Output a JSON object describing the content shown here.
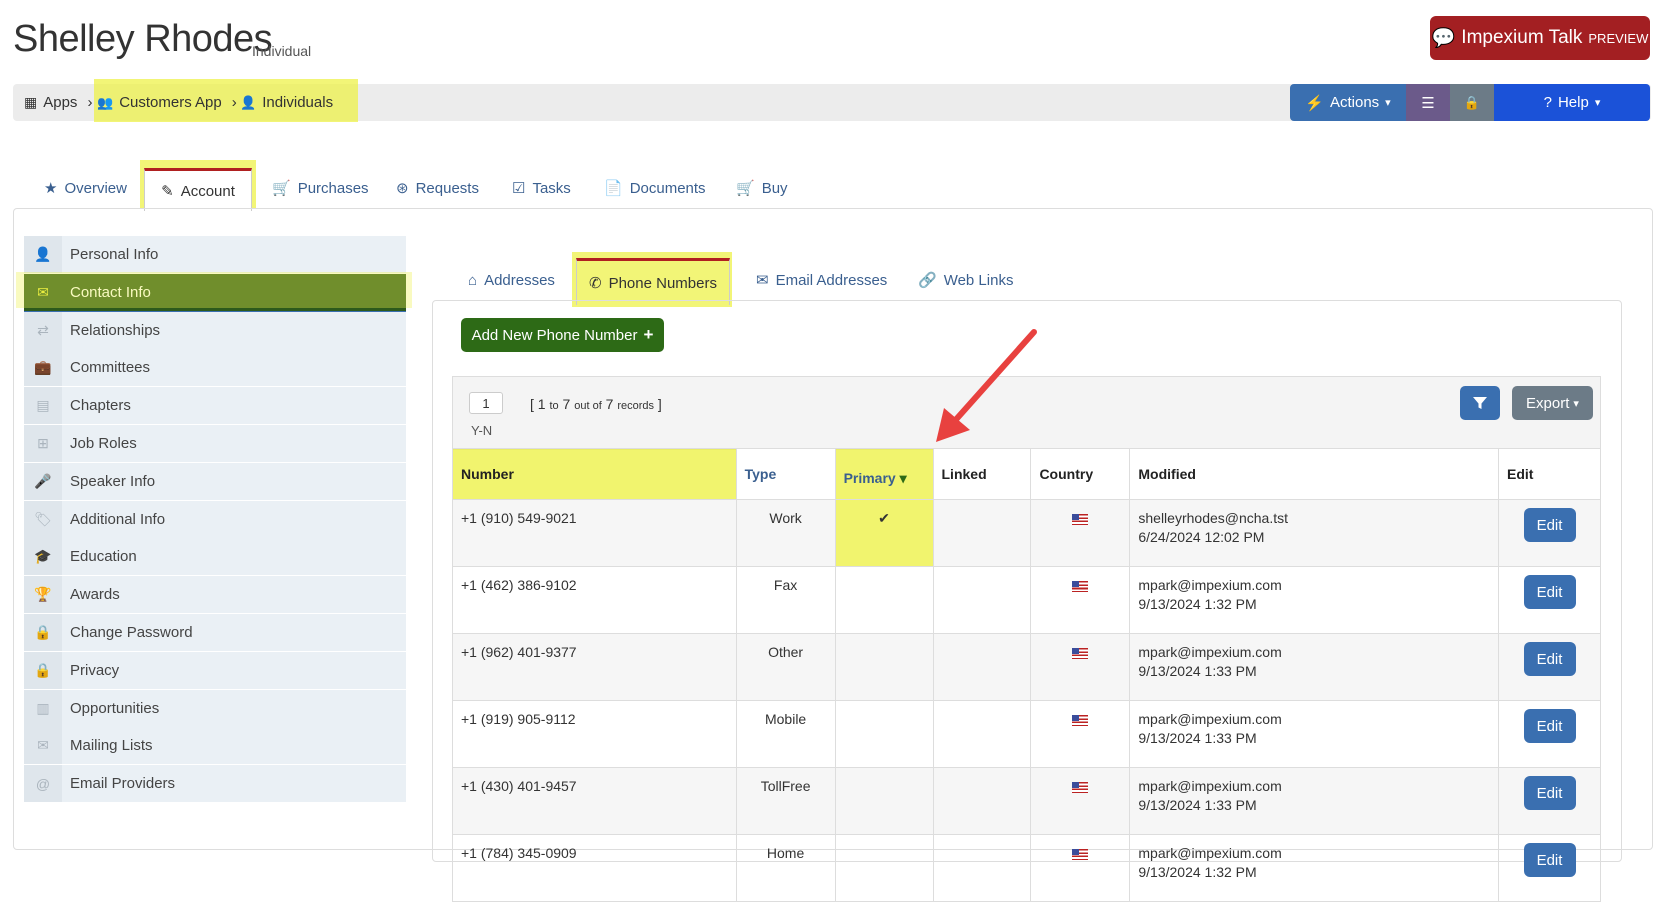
{
  "header": {
    "title": "Shelley Rhodes",
    "subtype": "Individual",
    "talk_button": "Impexium Talk",
    "talk_badge": "PREVIEW"
  },
  "breadcrumb": {
    "apps": "Apps",
    "customers_app": "Customers App",
    "individuals": "Individuals"
  },
  "toolbar": {
    "actions": "Actions",
    "help": "Help"
  },
  "tabs": [
    {
      "label": "Overview",
      "icon": "star-icon"
    },
    {
      "label": "Account",
      "icon": "edit-icon"
    },
    {
      "label": "Purchases",
      "icon": "cart-icon"
    },
    {
      "label": "Requests",
      "icon": "lifebuoy-icon"
    },
    {
      "label": "Tasks",
      "icon": "checklist-icon"
    },
    {
      "label": "Documents",
      "icon": "documents-icon"
    },
    {
      "label": "Buy",
      "icon": "cart-icon"
    }
  ],
  "sidebar": {
    "items": [
      {
        "label": "Personal Info",
        "icon": "user-icon"
      },
      {
        "label": "Contact Info",
        "icon": "envelope-icon"
      },
      {
        "label": "Relationships",
        "icon": "retweet-icon"
      },
      {
        "label": "Committees",
        "icon": "briefcase-icon"
      },
      {
        "label": "Chapters",
        "icon": "archive-icon"
      },
      {
        "label": "Job Roles",
        "icon": "sitemap-icon"
      },
      {
        "label": "Speaker Info",
        "icon": "microphone-icon"
      },
      {
        "label": "Additional Info",
        "icon": "tags-icon"
      },
      {
        "label": "Education",
        "icon": "graduation-cap-icon"
      },
      {
        "label": "Awards",
        "icon": "trophy-icon"
      },
      {
        "label": "Change Password",
        "icon": "lock-icon"
      },
      {
        "label": "Privacy",
        "icon": "lock-icon"
      },
      {
        "label": "Opportunities",
        "icon": "building-icon"
      },
      {
        "label": "Mailing Lists",
        "icon": "envelope-icon"
      },
      {
        "label": "Email Providers",
        "icon": "at-icon"
      }
    ]
  },
  "subtabs": [
    {
      "label": "Addresses",
      "icon": "home-icon"
    },
    {
      "label": "Phone Numbers",
      "icon": "phone-icon"
    },
    {
      "label": "Email Addresses",
      "icon": "envelope-icon"
    },
    {
      "label": "Web Links",
      "icon": "link-icon"
    }
  ],
  "add_button": "Add New Phone Number",
  "pager": {
    "page": "1",
    "range_start": "1",
    "range_to": "to",
    "range_end": "7",
    "out_of": "out of",
    "total": "7",
    "records": "records",
    "sort_label": "Y-N"
  },
  "export_button": "Export",
  "columns": [
    "Number",
    "Type",
    "Primary",
    "Linked",
    "Country",
    "Modified",
    "Edit"
  ],
  "rows": [
    {
      "number": "+1 (910) 549-9021",
      "type": "Work",
      "primary": "✔",
      "by": "shelleyrhodes@ncha.tst",
      "date": "6/24/2024 12:02 PM",
      "edit": "Edit"
    },
    {
      "number": "+1 (462) 386-9102",
      "type": "Fax",
      "primary": "",
      "by": "mpark@impexium.com",
      "date": "9/13/2024 1:32 PM",
      "edit": "Edit"
    },
    {
      "number": "+1 (962) 401-9377",
      "type": "Other",
      "primary": "",
      "by": "mpark@impexium.com",
      "date": "9/13/2024 1:33 PM",
      "edit": "Edit"
    },
    {
      "number": "+1 (919) 905-9112",
      "type": "Mobile",
      "primary": "",
      "by": "mpark@impexium.com",
      "date": "9/13/2024 1:33 PM",
      "edit": "Edit"
    },
    {
      "number": "+1 (430) 401-9457",
      "type": "TollFree",
      "primary": "",
      "by": "mpark@impexium.com",
      "date": "9/13/2024 1:33 PM",
      "edit": "Edit"
    },
    {
      "number": "+1 (784) 345-0909",
      "type": "Home",
      "primary": "",
      "by": "mpark@impexium.com",
      "date": "9/13/2024 1:32 PM",
      "edit": "Edit"
    }
  ],
  "colors": {
    "highlight": "#eef14a",
    "primary_blue": "#3a6fb0",
    "green": "#2d6a16",
    "talk_red": "#a31f22",
    "arrow_red": "#e8413f"
  }
}
